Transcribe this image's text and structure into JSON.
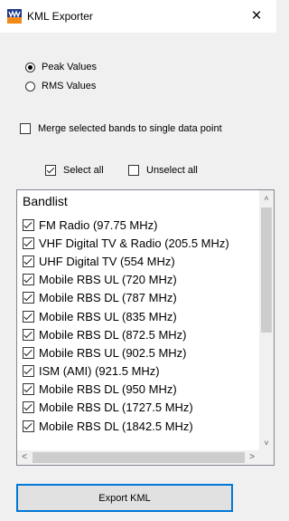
{
  "window": {
    "title": "KML Exporter",
    "close_label": "×"
  },
  "options": {
    "peak_label": "Peak Values",
    "rms_label": "RMS Values",
    "selected": "peak",
    "merge_label": "Merge selected bands to single data point",
    "merge_checked": false
  },
  "selection": {
    "select_all_label": "Select all",
    "select_all_checked": true,
    "unselect_all_label": "Unselect all",
    "unselect_all_checked": false
  },
  "bandlist": {
    "header": "Bandlist",
    "items": [
      {
        "label": "FM Radio (97.75 MHz)",
        "checked": true
      },
      {
        "label": "VHF Digital TV & Radio (205.5 MHz)",
        "checked": true
      },
      {
        "label": "UHF Digital TV (554 MHz)",
        "checked": true
      },
      {
        "label": "Mobile RBS UL (720 MHz)",
        "checked": true
      },
      {
        "label": "Mobile RBS DL (787 MHz)",
        "checked": true
      },
      {
        "label": "Mobile RBS UL (835 MHz)",
        "checked": true
      },
      {
        "label": "Mobile RBS DL (872.5 MHz)",
        "checked": true
      },
      {
        "label": "Mobile RBS UL (902.5 MHz)",
        "checked": true
      },
      {
        "label": "ISM (AMI) (921.5 MHz)",
        "checked": true
      },
      {
        "label": "Mobile RBS DL (950 MHz)",
        "checked": true
      },
      {
        "label": "Mobile RBS DL (1727.5 MHz)",
        "checked": true
      },
      {
        "label": "Mobile RBS DL (1842.5 MHz)",
        "checked": true
      }
    ],
    "scroll_up": "˄",
    "scroll_down": "˅",
    "scroll_left": "<",
    "scroll_right": ">"
  },
  "export_label": "Export KML",
  "colors": {
    "accent": "#0078d7"
  },
  "icons": {
    "app": "kml-exporter-app-icon"
  }
}
